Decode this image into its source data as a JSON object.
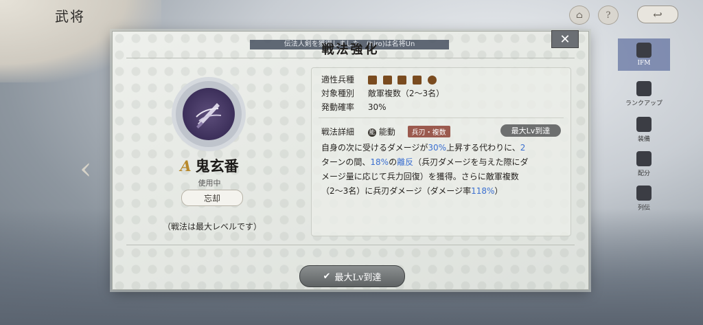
{
  "screen": {
    "title": "武将"
  },
  "side_menu": [
    {
      "label": "IFM"
    },
    {
      "label": "ランクアップ"
    },
    {
      "label": "装備"
    },
    {
      "label": "配分"
    },
    {
      "label": "列伝"
    }
  ],
  "dialog": {
    "title": "戦法強化",
    "notice": "伝法人剣を獲得しました　(hiro)は名将Un",
    "close_label": "✕",
    "skill": {
      "rank": "A",
      "name": "鬼玄番",
      "status": "使用中",
      "forget_label": "忘却",
      "max_note": "（戦法は最大レベルです）"
    },
    "info": {
      "troop_label": "適性兵種",
      "troop_icons": [
        "cavalry-icon",
        "bow-icon",
        "gun-icon",
        "spear-icon",
        "ship-wheel-icon"
      ],
      "target_label": "対象種別",
      "target_value": "敵軍複数（2〜3名）",
      "rate_label": "発動確率",
      "rate_value": "30%",
      "detail_label": "戦法詳細",
      "active_icon": "能",
      "active_label": "能動",
      "type_tag": "兵刃・複数",
      "maxlv_badge": "最大Lv到達",
      "desc_1a": "自身の次に受けるダメージが",
      "desc_1b": "30%",
      "desc_1c": "上昇する代わりに、",
      "desc_1d": "2",
      "desc_2a": "ターンの間、",
      "desc_2b": "18%",
      "desc_2c": "の",
      "desc_2d": "離反",
      "desc_2e": "（兵刃ダメージを与えた際にダ",
      "desc_3": "メージ量に応じて兵力回復）を獲得。さらに敵軍複数",
      "desc_4a": "（2〜3名）に兵刃ダメージ（ダメージ率",
      "desc_4b": "118%",
      "desc_4c": "）"
    },
    "bottom_button": "最大Lv到達"
  },
  "colors": {
    "highlight": "#3b6fd0",
    "rank": "#b8892c",
    "type_tag": "#9b5a4e"
  }
}
